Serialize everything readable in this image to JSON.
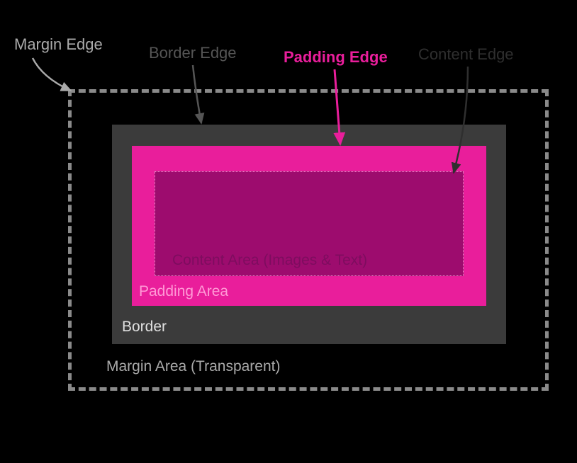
{
  "labels": {
    "margin_edge": "Margin Edge",
    "border_edge": "Border Edge",
    "padding_edge": "Padding Edge",
    "content_edge": "Content Edge"
  },
  "captions": {
    "content_area": "Content Area (Images & Text)",
    "padding_area": "Padding Area",
    "border": "Border",
    "margin_area": "Margin Area (Transparent)"
  },
  "colors": {
    "background": "#000000",
    "margin_dash": "#8a8a8a",
    "border_fill": "#3b3b3b",
    "padding_fill": "#e91e9b",
    "content_fill": "#9d0c6e",
    "label_gray_light": "#aaaaaa",
    "label_gray_dark": "#555555",
    "label_pink": "#e91e9b",
    "caption_pink_light": "#ff9ad6",
    "caption_purple": "#7e0c5f",
    "caption_white": "#e0e0e0"
  }
}
